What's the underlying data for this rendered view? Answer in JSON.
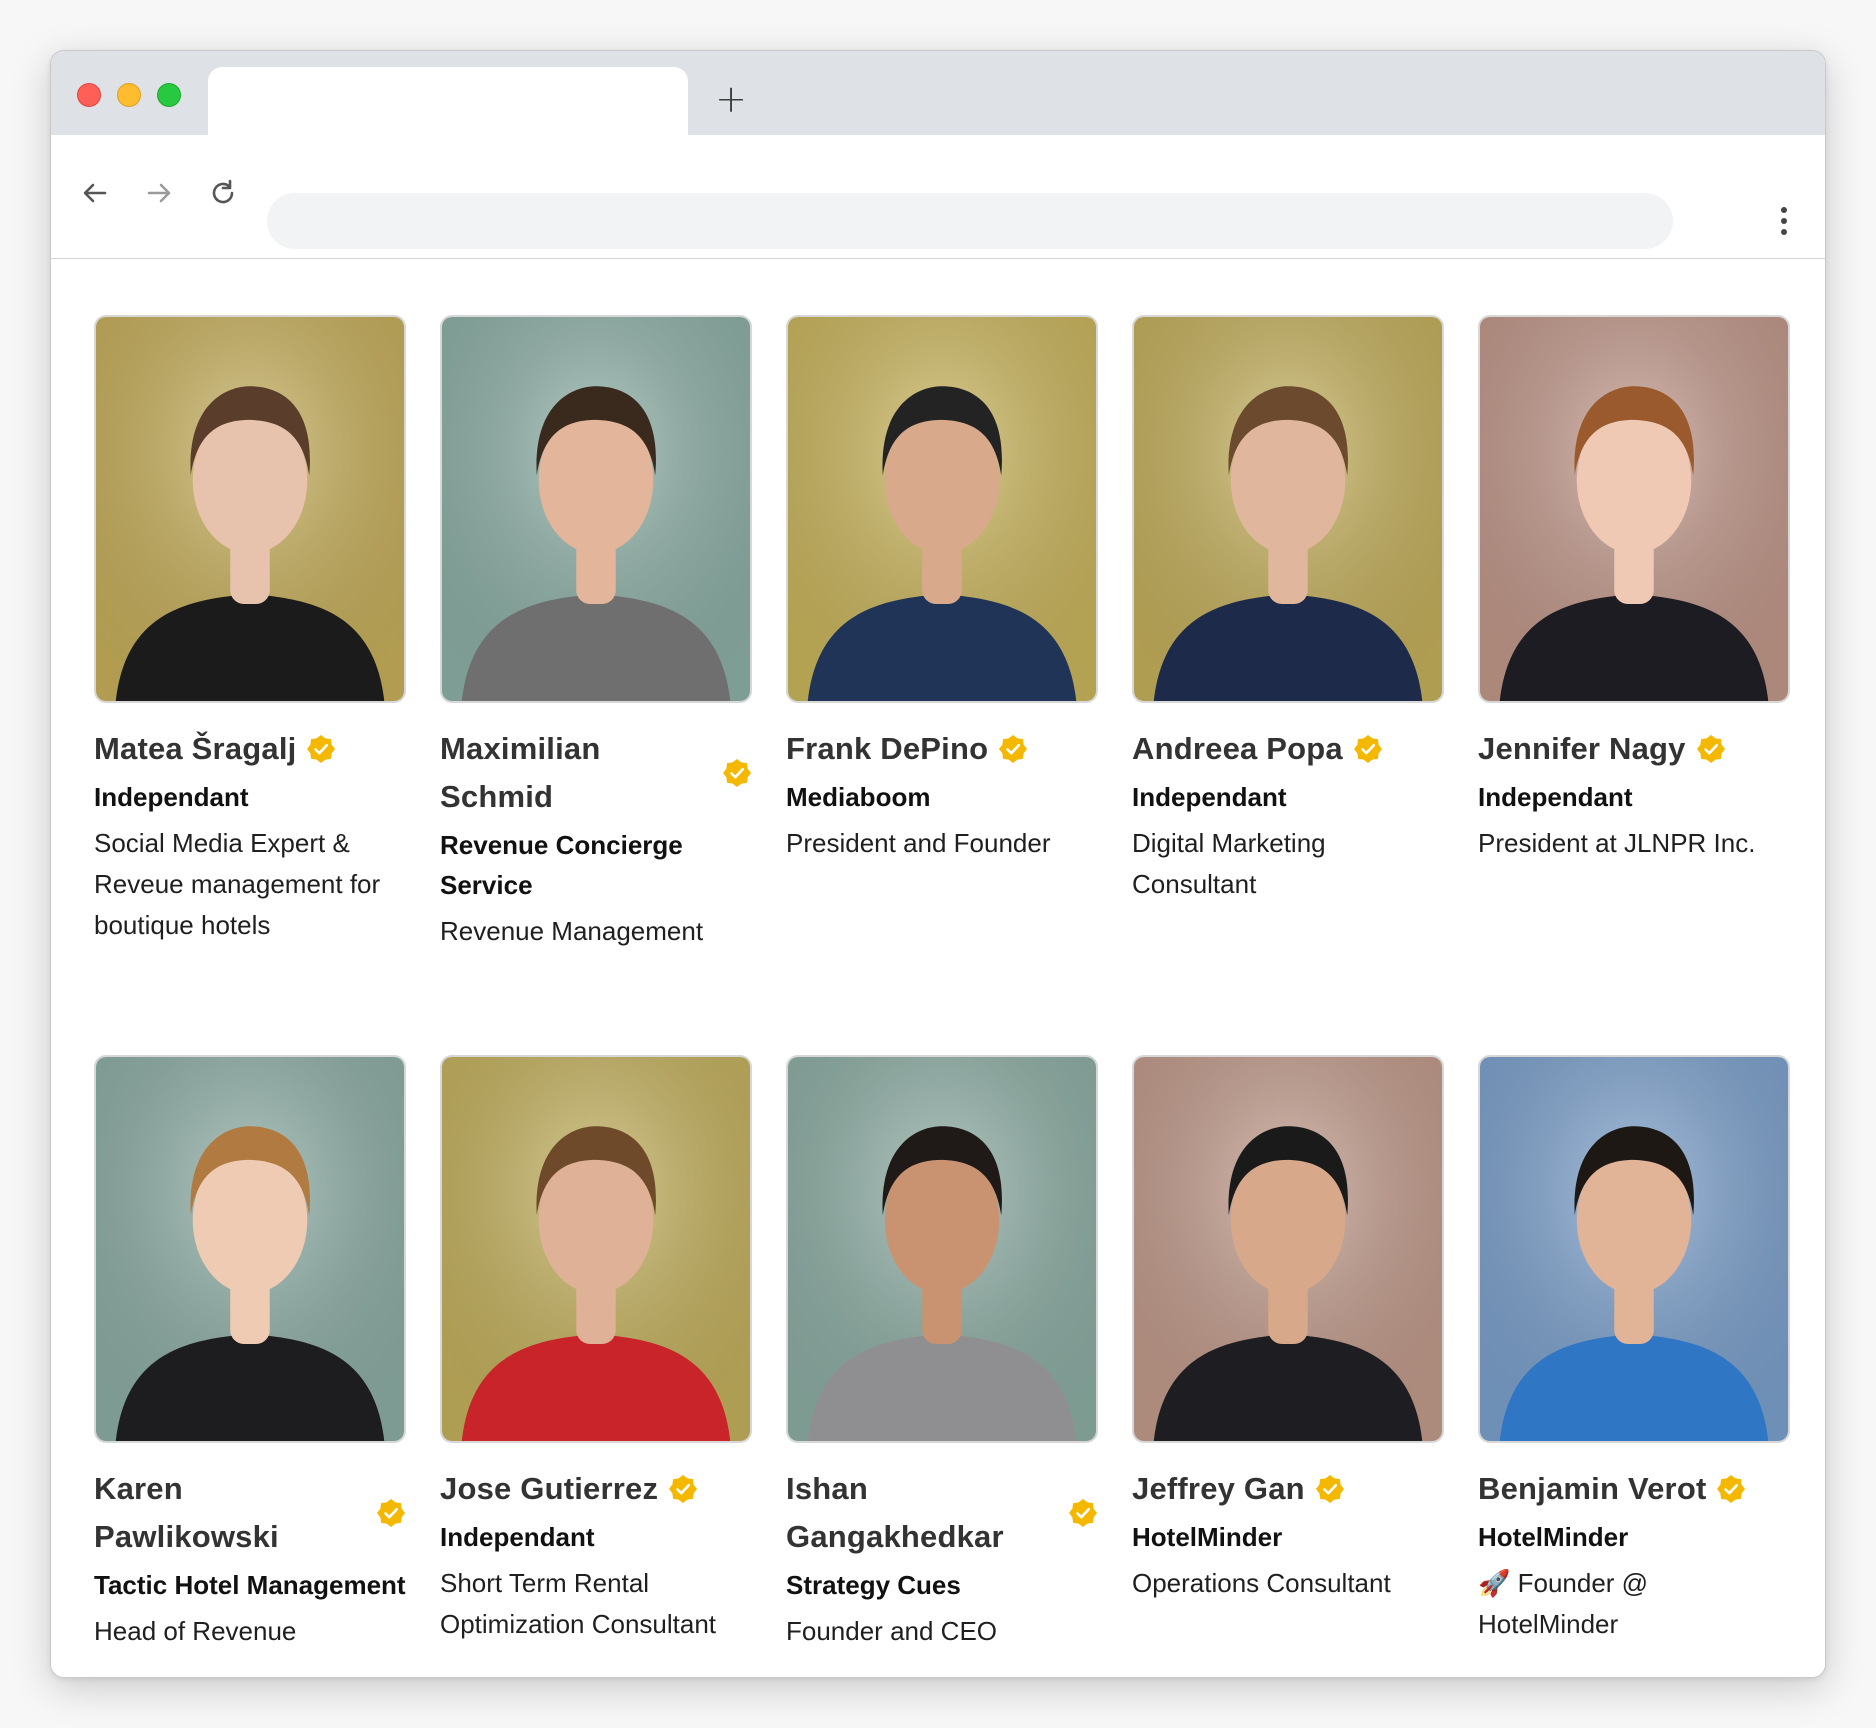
{
  "browser": {
    "tab_title": "",
    "new_tab_label": "+",
    "address_value": "",
    "address_placeholder": ""
  },
  "people": [
    {
      "name": "Matea Šragalj",
      "company": "Independant",
      "role": "Social Media Expert & Reveue management for boutique hotels",
      "bg": "#c9b15c",
      "verified": true
    },
    {
      "name": "Maximilian Schmid",
      "company": "Revenue Concierge Service",
      "role": "Revenue Management",
      "bg": "#8fb2a8",
      "verified": true
    },
    {
      "name": "Frank DePino",
      "company": "Mediaboom",
      "role": "President and Founder",
      "bg": "#cdb85e",
      "verified": true
    },
    {
      "name": "Andreea Popa",
      "company": "Independant",
      "role": "Digital Marketing Consultant",
      "bg": "#c7b25d",
      "verified": true
    },
    {
      "name": "Jennifer Nagy",
      "company": "Independant",
      "role": "President at JLNPR Inc.",
      "bg": "#c49a8c",
      "verified": true
    },
    {
      "name": "Karen Pawlikowski",
      "company": "Tactic Hotel Management",
      "role": "Head of Revenue",
      "bg": "#8fb0a7",
      "verified": true
    },
    {
      "name": "Jose Gutierrez",
      "company": "Independant",
      "role": "Short Term Rental Optimization Consultant",
      "bg": "#c6b35e",
      "verified": true
    },
    {
      "name": "Ishan Gangakhedkar",
      "company": "Strategy Cues",
      "role": "Founder and CEO",
      "bg": "#8fb0a6",
      "verified": true
    },
    {
      "name": "Jeffrey Gan",
      "company": "HotelMinder",
      "role": "Operations Consultant",
      "bg": "#c49d8d",
      "verified": true
    },
    {
      "name": "Benjamin Verot",
      "company": "HotelMinder",
      "role": "🚀 Founder @ HotelMinder",
      "bg": "#7ea3cf",
      "verified": true
    }
  ],
  "colors": {
    "badge": "#f5b800",
    "badge_check": "#ffffff"
  }
}
